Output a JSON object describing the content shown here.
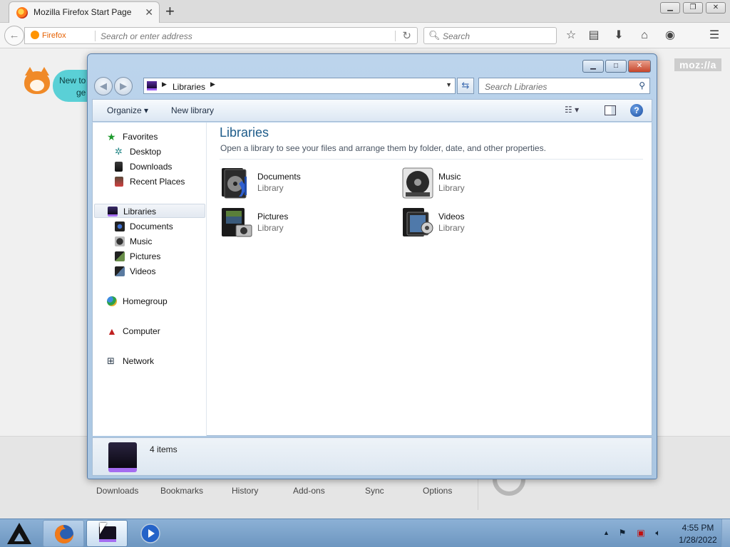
{
  "firefox": {
    "tab_title": "Mozilla Firefox Start Page",
    "new_tab_symbol": "+",
    "close_symbol": "✕",
    "identity_label": "Firefox",
    "url_placeholder": "Search or enter address",
    "search_placeholder": "Search",
    "toolbar_icons": [
      "star-icon",
      "reading-list-icon",
      "download-icon",
      "home-icon",
      "pocket-icon",
      "menu-icon"
    ],
    "bubble_text_1": "New to",
    "bubble_text_2": "ge",
    "mozilla_logo": "moz://a",
    "launchers": [
      "Downloads",
      "Bookmarks",
      "History",
      "Add-ons",
      "Sync",
      "Options"
    ]
  },
  "explorer": {
    "address_crumb": "Libraries",
    "search_placeholder": "Search Libraries",
    "toolbar": {
      "organize": "Organize",
      "new_library": "New library"
    },
    "nav": {
      "favorites": "Favorites",
      "favorites_items": [
        "Desktop",
        "Downloads",
        "Recent Places"
      ],
      "libraries": "Libraries",
      "libraries_items": [
        "Documents",
        "Music",
        "Pictures",
        "Videos"
      ],
      "homegroup": "Homegroup",
      "computer": "Computer",
      "network": "Network"
    },
    "main": {
      "title": "Libraries",
      "subtitle": "Open a library to see your files and arrange them by folder, date, and other properties.",
      "items": [
        {
          "name": "Documents",
          "type": "Library"
        },
        {
          "name": "Music",
          "type": "Library"
        },
        {
          "name": "Pictures",
          "type": "Library"
        },
        {
          "name": "Videos",
          "type": "Library"
        }
      ]
    },
    "status": {
      "count": "4 items"
    }
  },
  "taskbar": {
    "time": "4:55 PM",
    "date": "1/28/2022"
  },
  "colors": {
    "accent_title": "#1e5c8a",
    "library_purple": "#a46cf0",
    "taskbar_blue": "#7aa0c8",
    "firefox_orange": "#e66000"
  }
}
